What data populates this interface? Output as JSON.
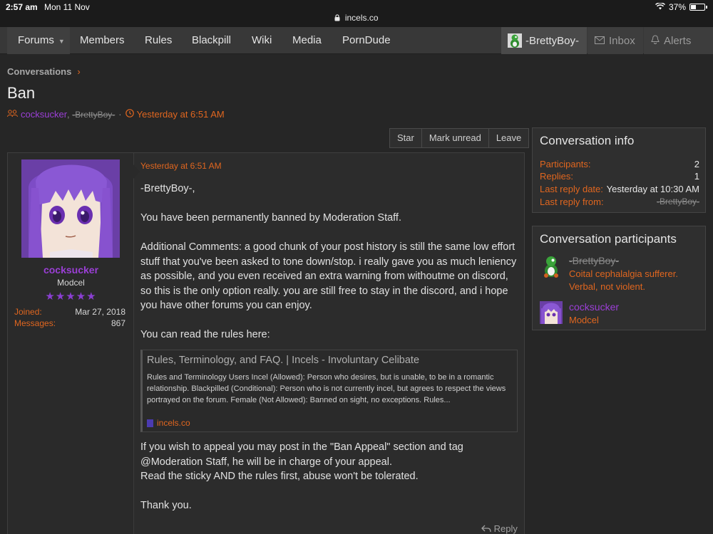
{
  "status": {
    "time": "2:57 am",
    "date": "Mon 11 Nov",
    "battery": "37%",
    "url": "incels.co"
  },
  "nav": {
    "tabs": [
      "Forums",
      "Members",
      "Rules",
      "Blackpill",
      "Wiki",
      "Media",
      "PornDude"
    ],
    "user": "-BrettyBoy-",
    "inbox": "Inbox",
    "alerts": "Alerts"
  },
  "breadcrumb": {
    "label": "Conversations",
    "sep": "›"
  },
  "page": {
    "title": "Ban",
    "participant1": "cocksucker",
    "comma": ",",
    "participant2": "-BrettyBoy-",
    "dot": "·",
    "date": "Yesterday at 6:51 AM"
  },
  "actions": {
    "star": "Star",
    "mark_unread": "Mark unread",
    "leave": "Leave"
  },
  "message": {
    "date": "Yesterday at 6:51 AM",
    "author": {
      "name": "cocksucker",
      "title": "Modcel",
      "stars": "★★★★★",
      "joined_label": "Joined:",
      "joined": "Mar 27, 2018",
      "messages_label": "Messages:",
      "messages": "867"
    },
    "p1": "-BrettyBoy-,",
    "p2": "You have been permanently banned by Moderation Staff.",
    "p3": "Additional Comments: a good chunk of your post history is still the same low effort stuff that you've been asked to tone down/stop. i really gave you as much leniency as possible, and you even received an extra warning from withoutme on discord, so this is the only option really. you are still free to stay in the discord, and i hope you have other forums you can enjoy.",
    "p4": "You can read the rules here:",
    "unfurl": {
      "title": "Rules, Terminology, and FAQ. | Incels - Involuntary Celibate",
      "desc": "Rules and Terminology Users Incel (Allowed): Person who desires, but is unable, to be in a romantic relationship. Blackpilled (Conditional): Person who is not currently incel, but agrees to respect the views portrayed on the forum. Female (Not Allowed): Banned on sight, no exceptions. Rules...",
      "site": "incels.co"
    },
    "p5a": "If you wish to appeal you may post in the \"Ban Appeal\" section and tag @Moderation Staff, he will be in charge of your appeal.",
    "p5b": "Read the sticky AND the rules first, abuse won't be tolerated.",
    "p6": "Thank you.",
    "reply": "Reply"
  },
  "info": {
    "title": "Conversation info",
    "participants_label": "Participants:",
    "participants": "2",
    "replies_label": "Replies:",
    "replies": "1",
    "last_reply_date_label": "Last reply date:",
    "last_reply_date": "Yesterday at 10:30 AM",
    "last_reply_from_label": "Last reply from:",
    "last_reply_from": "-BrettyBoy-"
  },
  "participants_box": {
    "title": "Conversation participants",
    "list": [
      {
        "name": "-BrettyBoy-",
        "sub1": "Coital cephalalgia sufferer.",
        "sub2": "Verbal, not violent."
      },
      {
        "name": "cocksucker",
        "sub1": "Modcel"
      }
    ]
  },
  "colors": {
    "accent": "#e0661f",
    "mod_purple": "#9b3fd6",
    "background": "#262626"
  }
}
